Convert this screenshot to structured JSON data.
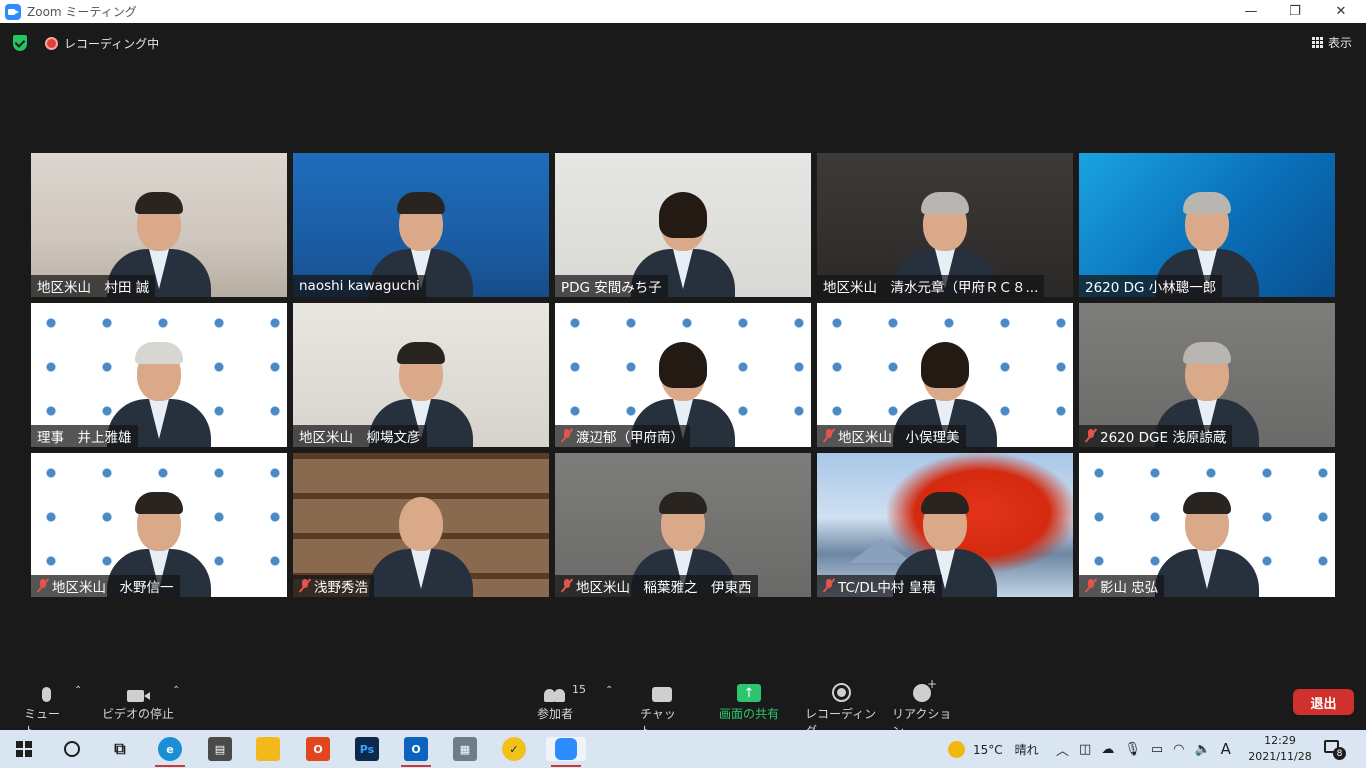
{
  "window": {
    "title": "Zoom ミーティング"
  },
  "topbar": {
    "recording_label": "レコーディング中",
    "view_label": "表示"
  },
  "participants": [
    {
      "name": "地区米山　村田 誠",
      "muted": false,
      "active": false,
      "bg": "room",
      "hair": ""
    },
    {
      "name": "naoshi kawaguchi",
      "muted": false,
      "active": false,
      "bg": "blue",
      "hair": ""
    },
    {
      "name": "PDG 安間みち子",
      "muted": false,
      "active": false,
      "bg": "plain",
      "hair": "woman"
    },
    {
      "name": "地区米山　清水元章（甲府ＲＣ８...",
      "muted": false,
      "active": false,
      "bg": "dark",
      "hair": "gray"
    },
    {
      "name": "2620 DG 小林聰一郎",
      "muted": false,
      "active": false,
      "bg": "rotary",
      "hair": "gray"
    },
    {
      "name": "理事　井上雅雄",
      "muted": false,
      "active": false,
      "bg": "logo",
      "hair": "light"
    },
    {
      "name": "地区米山　柳場文彦",
      "muted": false,
      "active": true,
      "bg": "office",
      "hair": ""
    },
    {
      "name": "渡辺郁（甲府南）",
      "muted": true,
      "active": false,
      "bg": "logo",
      "hair": "woman"
    },
    {
      "name": "地区米山　小俣理美",
      "muted": true,
      "active": false,
      "bg": "logo",
      "hair": "woman"
    },
    {
      "name": "2620 DGE 浅原諒蔵",
      "muted": true,
      "active": false,
      "bg": "gray",
      "hair": "gray"
    },
    {
      "name": "地区米山　水野信一",
      "muted": true,
      "active": false,
      "bg": "logo",
      "hair": ""
    },
    {
      "name": "浅野秀浩",
      "muted": true,
      "active": false,
      "bg": "shelf",
      "hair": "none"
    },
    {
      "name": "地区米山　稲葉雅之　伊東西",
      "muted": true,
      "active": false,
      "bg": "gray",
      "hair": ""
    },
    {
      "name": "TC/DL中村 皇積",
      "muted": true,
      "active": false,
      "bg": "autumn",
      "hair": ""
    },
    {
      "name": "影山 忠弘",
      "muted": true,
      "active": false,
      "bg": "logo",
      "hair": ""
    }
  ],
  "toolbar": {
    "mute_label": "ミュート",
    "video_label": "ビデオの停止",
    "participants_label": "参加者",
    "participants_count": "15",
    "chat_label": "チャット",
    "share_label": "画面の共有",
    "record_label": "レコーディング",
    "reaction_label": "リアクション",
    "leave_label": "退出"
  },
  "taskbar": {
    "weather": "15°C　晴れ",
    "ime": "A",
    "time": "12:29",
    "date": "2021/11/28",
    "notifications": "8"
  },
  "colors": {
    "accent_green": "#2dc66e",
    "leave_red": "#d0312d",
    "active_speaker": "#c7e24a",
    "muted_red": "#e5544b"
  }
}
